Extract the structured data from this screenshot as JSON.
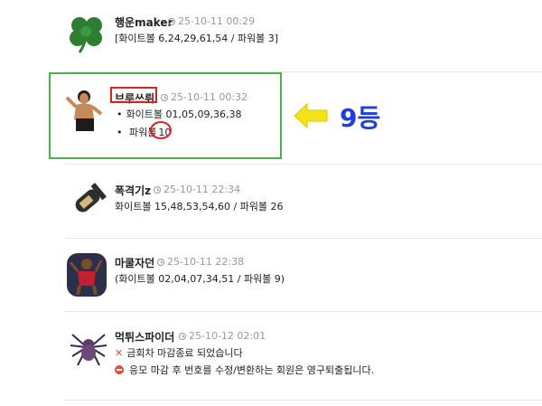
{
  "posts": [
    {
      "name": "행운maker",
      "time": "25-10-11 00:29",
      "line1": "[화이트볼 6,24,29,61,54 / 파워볼 3]",
      "avatar": "clover-icon"
    },
    {
      "name": "브루쓰뤼",
      "time": "25-10-11 00:32",
      "white_label": "화이트볼 01,05,09,36,38",
      "power_label": "파워볼",
      "power_value": "10",
      "avatar": "martial-artist-avatar"
    },
    {
      "name": "폭격기z",
      "time": "25-10-11 22:34",
      "line1": "화이트볼 15,48,53,54,60 / 파워볼 26",
      "avatar": "bomb-icon"
    },
    {
      "name": "마쿨자던",
      "time": "25-10-11 22:38",
      "line1": "(화이트볼 02,04,07,34,51 / 파워볼 9)",
      "avatar": "basketball-player-avatar"
    },
    {
      "name": "먹튀스파이더",
      "time": "25-10-12 02:01",
      "line1": "금회차 마감종료 되었습니다",
      "line2": "응모 마감 후 번호를 수정/변환하는 회원은 영구퇴출됩니다.",
      "avatar": "spider-icon"
    }
  ],
  "annotation": {
    "rank_label": "9등",
    "arrow_color": "#f5e31a",
    "rank_color": "#1f3fd8",
    "box_color": "#4caf50",
    "mark_color": "#e02020"
  }
}
